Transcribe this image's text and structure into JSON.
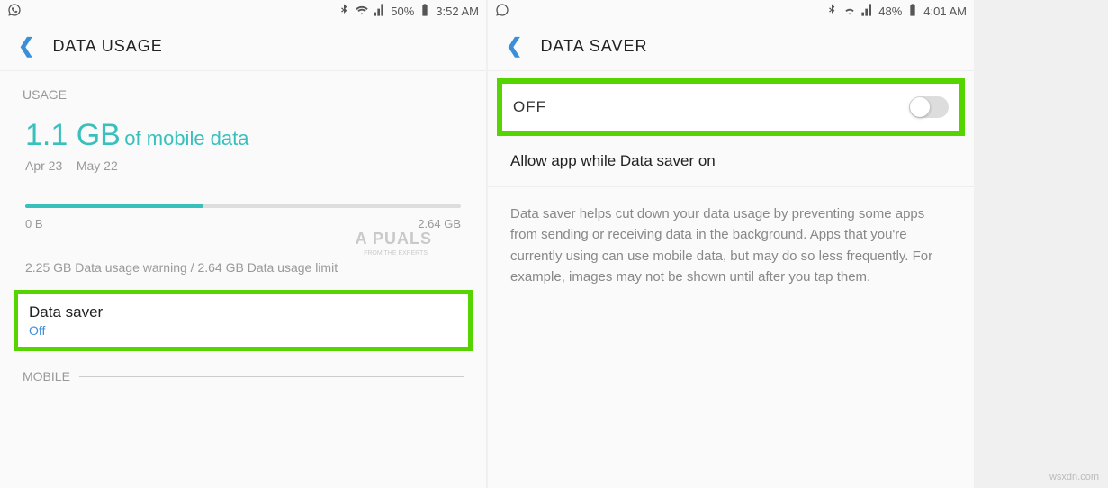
{
  "left": {
    "statusbar": {
      "battery": "50%",
      "time": "3:52 AM"
    },
    "header": {
      "title": "DATA USAGE"
    },
    "section_usage": "USAGE",
    "usage": {
      "amount": "1.1 GB",
      "suffix": " of mobile data",
      "range": "Apr 23 – May 22"
    },
    "progress": {
      "min": "0 B",
      "max": "2.64 GB"
    },
    "warning": "2.25 GB Data usage warning / 2.64 GB Data usage limit",
    "data_saver": {
      "title": "Data saver",
      "status": "Off"
    },
    "section_mobile": "MOBILE",
    "watermark_brand": "A PUALS",
    "watermark_sub": "FROM THE EXPERTS"
  },
  "right": {
    "statusbar": {
      "battery": "48%",
      "time": "4:01 AM"
    },
    "header": {
      "title": "DATA SAVER"
    },
    "toggle": {
      "label": "OFF"
    },
    "allow_row": "Allow app while Data saver on",
    "description": "Data saver helps cut down your data usage by preventing some apps from sending or receiving data in the background. Apps that you're currently using can use mobile data, but may do so less frequently. For example, images may not be shown until after you tap them."
  },
  "footer_watermark": "wsxdn.com"
}
